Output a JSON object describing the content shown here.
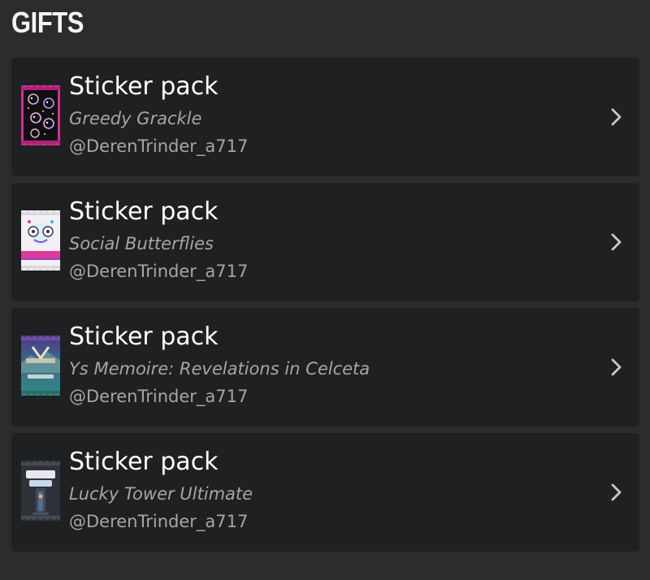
{
  "section": {
    "title": "GIFTS"
  },
  "gifts": [
    {
      "title": "Sticker pack",
      "game": "Greedy Grackle",
      "user": "@DerenTrinder_a717",
      "icon": "greedy-grackle-pack-icon"
    },
    {
      "title": "Sticker pack",
      "game": "Social Butterflies",
      "user": "@DerenTrinder_a717",
      "icon": "social-butterflies-pack-icon"
    },
    {
      "title": "Sticker pack",
      "game": "Ys Memoire: Revelations in Celceta",
      "user": "@DerenTrinder_a717",
      "icon": "ys-memoire-pack-icon"
    },
    {
      "title": "Sticker pack",
      "game": "Lucky Tower Ultimate",
      "user": "@DerenTrinder_a717",
      "icon": "lucky-tower-pack-icon"
    }
  ],
  "colors": {
    "background": "#2b2c2e",
    "card": "#1f2021",
    "secondary_text": "#a4a6a9"
  }
}
